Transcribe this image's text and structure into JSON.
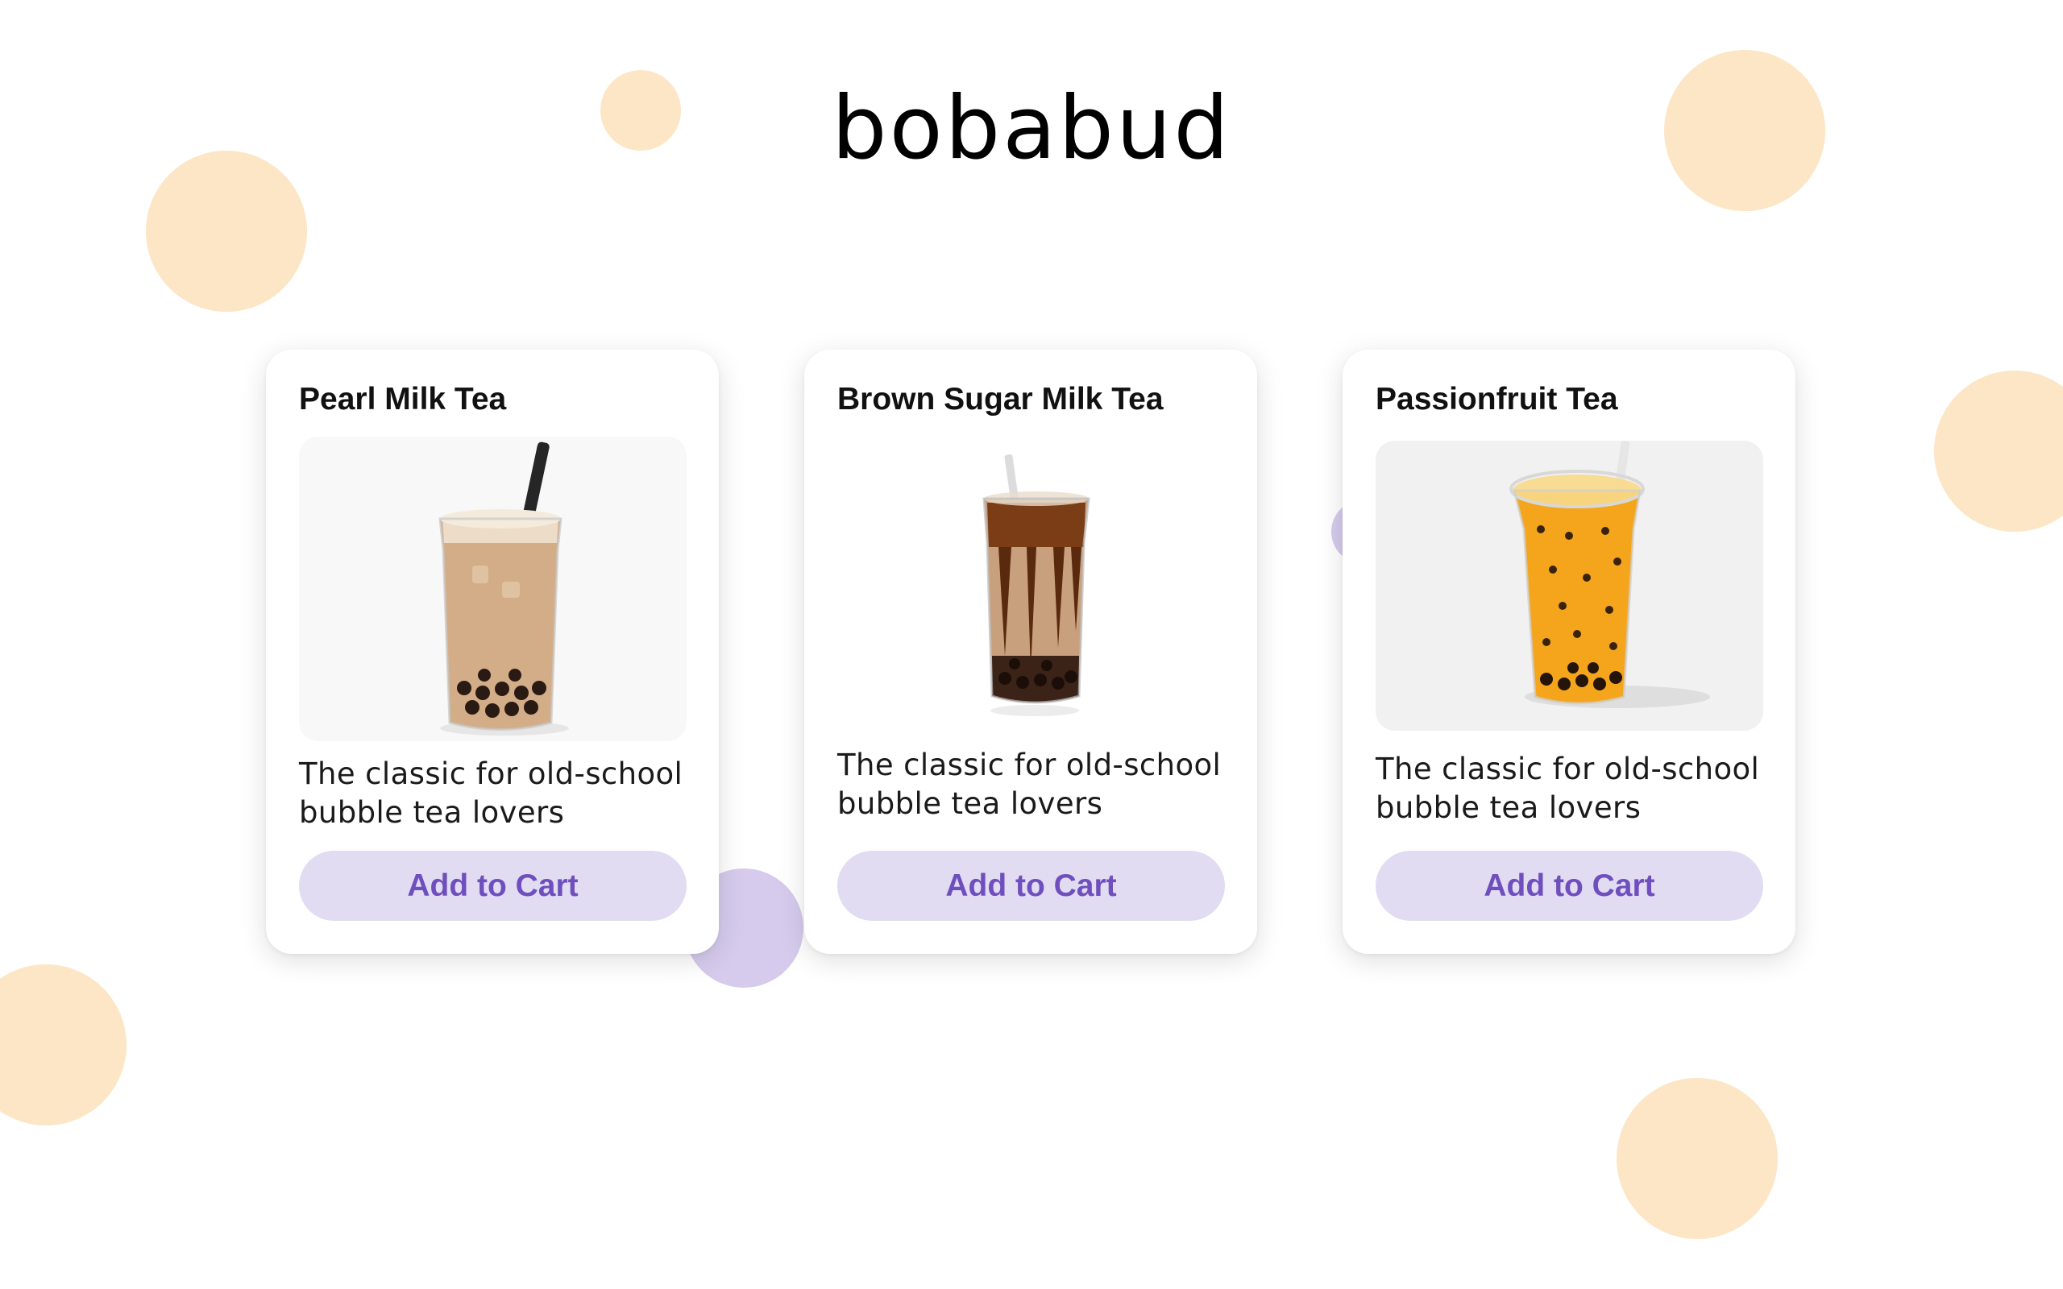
{
  "brand": {
    "logo": "bobabud"
  },
  "colors": {
    "decor_peach": "#fce6c6",
    "decor_lavender": "#d6cbed",
    "button_bg": "#e2dcf3",
    "button_text": "#6f4fbe"
  },
  "products": [
    {
      "name": "Pearl Milk Tea",
      "image": "pearl-milk-tea-photo",
      "description": "The classic for old-school bubble tea lovers",
      "button_label": "Add to Cart"
    },
    {
      "name": "Brown Sugar Milk Tea",
      "image": "brown-sugar-milk-tea-photo",
      "description": "The classic for old-school bubble tea lovers",
      "button_label": "Add to Cart"
    },
    {
      "name": "Passionfruit Tea",
      "image": "passionfruit-tea-photo",
      "description": "The classic for old-school bubble tea lovers",
      "button_label": "Add to Cart"
    }
  ]
}
